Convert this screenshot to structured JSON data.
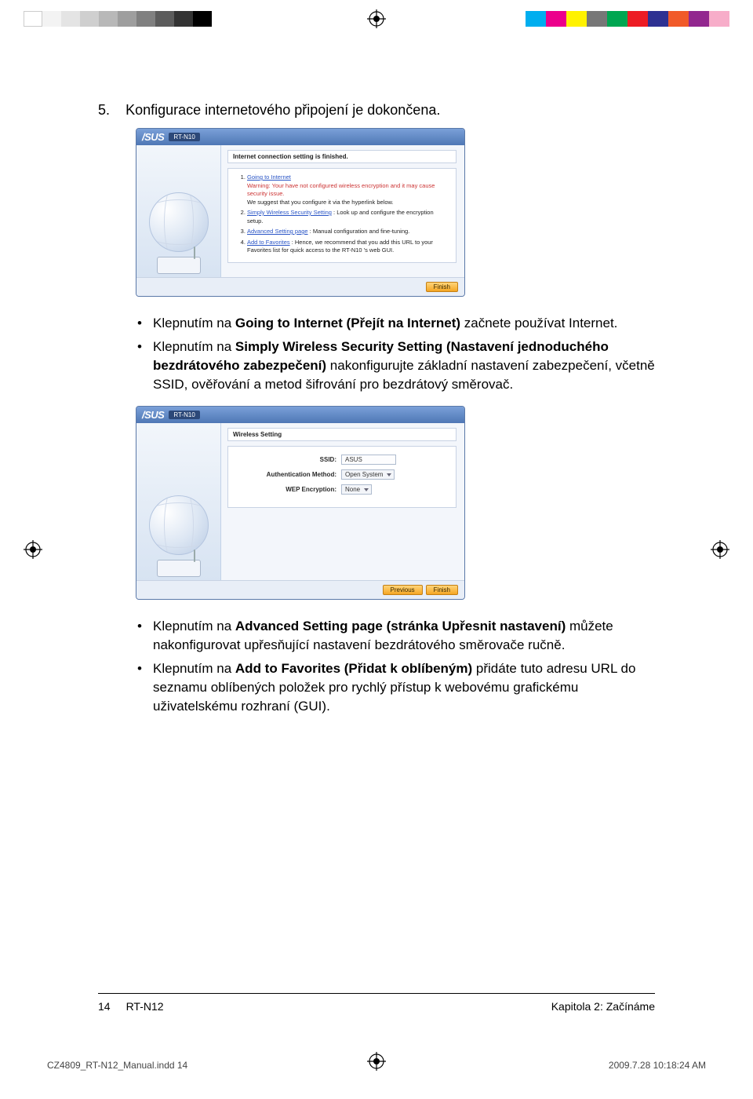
{
  "print_marks": {
    "grayscale": [
      "#fff",
      "#f3f3f3",
      "#e4e4e4",
      "#cfcfcf",
      "#b8b8b8",
      "#9e9e9e",
      "#808080",
      "#5c5c5c",
      "#333",
      "#000"
    ],
    "colors": [
      "#00aeef",
      "#ec008c",
      "#fff200",
      "#777",
      "#00a651",
      "#ed1c24",
      "#2e3192",
      "#f15a29",
      "#92278f",
      "#f7adc9"
    ]
  },
  "step5": {
    "number": "5.",
    "text": "Konfigurace internetového připojení je dokončena."
  },
  "screenshot1": {
    "brand": "/SUS",
    "model": "RT-N10",
    "panel_title": "Internet connection setting is finished.",
    "items": [
      {
        "link": "Going to Internet",
        "warn": "Warning: Your have not configured wireless encryption and it may cause security issue.",
        "rest": "We suggest that you configure it via the hyperlink below."
      },
      {
        "link": "Simply Wireless Security Setting",
        "rest": " : Look up and configure the encryption setup."
      },
      {
        "link": "Advanced Setting page",
        "rest": ": Manual configuration and fine-tuning."
      },
      {
        "link": "Add to Favorites",
        "rest": ": Hence, we recommend that you add this URL to your Favorites list for quick access to the RT-N10 's web GUI."
      }
    ],
    "finish": "Finish"
  },
  "bullets_a": [
    {
      "pre": "Klepnutím na ",
      "bold": "Going to Internet (Přejít na Internet)",
      "post": " začnete používat Internet."
    },
    {
      "pre": "Klepnutím na ",
      "bold": "Simply Wireless Security Setting (Nastavení jednoduchého bezdrátového zabezpečení)",
      "post": " nakonfigurujte základní nastavení zabezpečení, včetně SSID, ověřování a metod šifrování pro bezdrátový směrovač."
    }
  ],
  "screenshot2": {
    "brand": "/SUS",
    "model": "RT-N10",
    "panel_title": "Wireless Setting",
    "fields": {
      "ssid_label": "SSID:",
      "ssid_value": "ASUS",
      "auth_label": "Authentication Method:",
      "auth_value": "Open System",
      "wep_label": "WEP Encryption:",
      "wep_value": "None"
    },
    "previous": "Previous",
    "finish": "Finish"
  },
  "bullets_b": [
    {
      "pre": "Klepnutím na ",
      "bold": "Advanced Setting page (stránka Upřesnit nastavení)",
      "post": " můžete nakonfigurovat upřesňující nastavení bezdrátového směrovače ručně."
    },
    {
      "pre": "Klepnutím na ",
      "bold": "Add to Favorites (Přidat k oblíbeným)",
      "post": " přidáte tuto adresu URL do seznamu oblíbených položek pro rychlý přístup k webovému grafickému uživatelskému rozhraní (GUI)."
    }
  ],
  "footer": {
    "page": "14",
    "model": "RT-N12",
    "chapter": "Kapitola 2: Začínáme"
  },
  "slug": {
    "file": "CZ4809_RT-N12_Manual.indd   14",
    "date": "2009.7.28   10:18:24 AM"
  }
}
